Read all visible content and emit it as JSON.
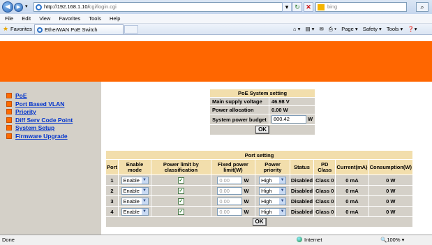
{
  "browser": {
    "url": "http://192.168.1.10/cgi/login.cgi",
    "url_host": "http://192.168.1.10/",
    "url_path": "cgi/login.cgi",
    "search_placeholder": "bing",
    "tab_title": "EtherWAN PoE Switch",
    "favorites_label": "Favorites",
    "menu": [
      "File",
      "Edit",
      "View",
      "Favorites",
      "Tools",
      "Help"
    ],
    "commands": [
      "Page ▾",
      "Safety ▾",
      "Tools ▾"
    ]
  },
  "sidebar": {
    "items": [
      {
        "label": "PoE"
      },
      {
        "label": "Port Based VLAN"
      },
      {
        "label": "Priority"
      },
      {
        "label": "Diff Serv Code Point"
      },
      {
        "label": "System Setup"
      },
      {
        "label": "Firmware Upgrade"
      }
    ]
  },
  "poe_system": {
    "title": "PoE System setting",
    "rows": [
      {
        "label": "Main supply voltage",
        "value": "46.98 V"
      },
      {
        "label": "Power allocation",
        "value": "0.00 W"
      },
      {
        "label": "System power budget",
        "value": "800.42",
        "unit": "W"
      }
    ],
    "ok": "OK"
  },
  "port_setting": {
    "title": "Port setting",
    "headers": [
      "Port",
      "Enable mode",
      "Power limit by classification",
      "Fixed power limit(W)",
      "Power priority",
      "Status",
      "PD Class",
      "Current(mA)",
      "Consumption(W)"
    ],
    "rows": [
      {
        "port": "1",
        "enable": "Enable",
        "limit_checked": true,
        "fixed": "0.00",
        "unit": "W",
        "priority": "High",
        "status": "Disabled",
        "pd_class": "Class 0",
        "current": "0 mA",
        "consumption": "0 W"
      },
      {
        "port": "2",
        "enable": "Enable",
        "limit_checked": true,
        "fixed": "0.00",
        "unit": "W",
        "priority": "High",
        "status": "Disabled",
        "pd_class": "Class 0",
        "current": "0 mA",
        "consumption": "0 W"
      },
      {
        "port": "3",
        "enable": "Enable",
        "limit_checked": true,
        "fixed": "0.00",
        "unit": "W",
        "priority": "High",
        "status": "Disabled",
        "pd_class": "Class 0",
        "current": "0 mA",
        "consumption": "0 W"
      },
      {
        "port": "4",
        "enable": "Enable",
        "limit_checked": true,
        "fixed": "0.00",
        "unit": "W",
        "priority": "High",
        "status": "Disabled",
        "pd_class": "Class 0",
        "current": "0 mA",
        "consumption": "0 W"
      }
    ],
    "ok": "OK"
  },
  "status": {
    "left": "Done",
    "zone": "Internet",
    "zoom": "100%"
  },
  "colors": {
    "banner": "#ff6600",
    "sidebar": "#d4d0c8",
    "header": "#f2deac"
  }
}
